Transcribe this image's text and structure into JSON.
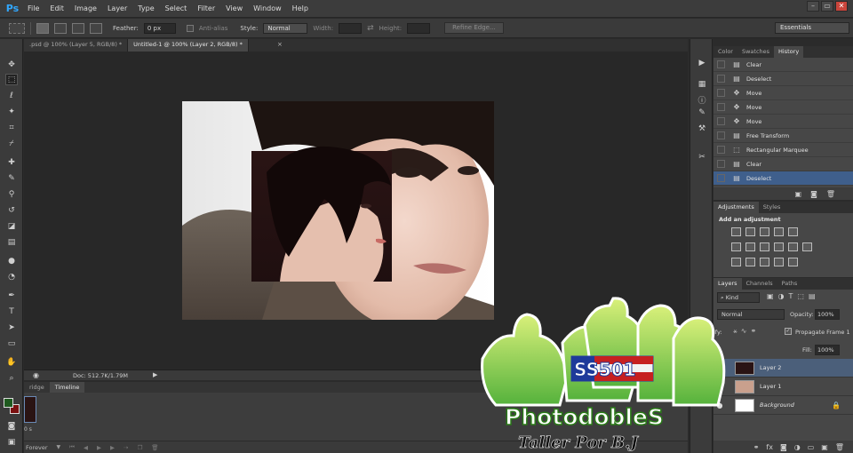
{
  "app": {
    "logo": "Ps",
    "menus": [
      "File",
      "Edit",
      "Image",
      "Layer",
      "Type",
      "Select",
      "Filter",
      "View",
      "Window",
      "Help"
    ],
    "window_controls": [
      "–",
      "▭",
      "✕"
    ]
  },
  "options_bar": {
    "feather_label": "Feather:",
    "feather_value": "0 px",
    "antialias_label": "Anti-alias",
    "style_label": "Style:",
    "style_value": "Normal",
    "width_label": "Width:",
    "height_label": "Height:",
    "refine_edge": "Refine Edge...",
    "workspace": "Essentials"
  },
  "doc_tabs": [
    {
      "label": ".psd @ 100% (Layer 5, RGB/8) *",
      "active": false
    },
    {
      "label": "Untitled-1 @ 100% (Layer 2, RGB/8) *",
      "active": true
    }
  ],
  "status": {
    "doc": "Doc: 512.7K/1.79M"
  },
  "timeline": {
    "tabs": [
      "ridge",
      "Timeline"
    ],
    "loop": "Forever"
  },
  "history_panel": {
    "tabs": [
      "Color",
      "Swatches",
      "History"
    ],
    "items": [
      {
        "label": "Clear",
        "icon": "doc-icon",
        "selected": false
      },
      {
        "label": "Deselect",
        "icon": "doc-icon",
        "selected": false
      },
      {
        "label": "Move",
        "icon": "move-icon",
        "selected": false
      },
      {
        "label": "Move",
        "icon": "move-icon",
        "selected": false
      },
      {
        "label": "Move",
        "icon": "move-icon",
        "selected": false
      },
      {
        "label": "Free Transform",
        "icon": "doc-icon",
        "selected": false
      },
      {
        "label": "Rectangular Marquee",
        "icon": "marquee-icon",
        "selected": false
      },
      {
        "label": "Clear",
        "icon": "doc-icon",
        "selected": false
      },
      {
        "label": "Deselect",
        "icon": "doc-icon",
        "selected": true
      }
    ]
  },
  "adjustments_panel": {
    "tabs": [
      "Adjustments",
      "Styles"
    ],
    "heading": "Add an adjustment"
  },
  "layers_panel": {
    "tabs": [
      "Layers",
      "Channels",
      "Paths"
    ],
    "kind": "Kind",
    "blend_mode": "Normal",
    "opacity_label": "Opacity:",
    "opacity_value": "100%",
    "lock_label": "ify:",
    "propagate_label": "Propagate Frame 1",
    "fill_label": "Fill:",
    "fill_value": "100%",
    "layers": [
      {
        "name": "Layer 2",
        "selected": true
      },
      {
        "name": "Layer 1",
        "selected": false
      },
      {
        "name": "Background",
        "selected": false
      }
    ]
  },
  "watermark": {
    "badge": "SS501",
    "title": "PhotodobleS",
    "subtitle": "Taller Por B.J"
  },
  "colors": {
    "selection_blue": "#3f5f8c",
    "ps_blue": "#31a8ff",
    "foreground_color": "#1f5a1f",
    "background_color": "#7a1010"
  }
}
